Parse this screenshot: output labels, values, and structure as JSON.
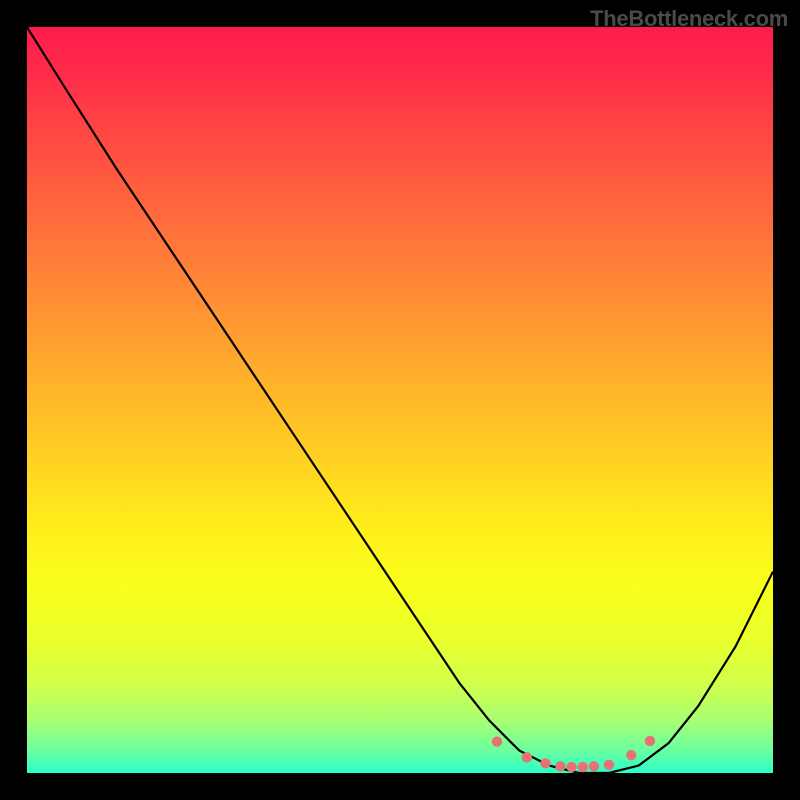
{
  "watermark": "TheBottleneck.com",
  "chart_data": {
    "type": "line",
    "title": "",
    "xlabel": "",
    "ylabel": "",
    "xlim": [
      0,
      100
    ],
    "ylim": [
      0,
      100
    ],
    "grid": false,
    "legend": false,
    "series": [
      {
        "name": "bottleneck-curve",
        "x": [
          0,
          5,
          12,
          20,
          28,
          36,
          44,
          52,
          58,
          62,
          66,
          70,
          74,
          78,
          82,
          86,
          90,
          95,
          100
        ],
        "y": [
          100,
          92,
          81,
          69,
          57,
          45,
          33,
          21,
          12,
          7,
          3,
          1,
          0,
          0,
          1,
          4,
          9,
          17,
          27
        ]
      }
    ],
    "scatter_points": {
      "name": "highlight-points",
      "x": [
        63,
        67,
        69.5,
        71.5,
        73,
        74.5,
        76,
        78,
        81,
        83.5
      ],
      "y": [
        4.2,
        2.1,
        1.3,
        0.9,
        0.8,
        0.8,
        0.9,
        1.1,
        2.4,
        4.3
      ]
    },
    "background_gradient": {
      "top": "#ff1a4d",
      "middle": "#ffd820",
      "bottom": "#2affc9"
    },
    "colors": {
      "curve": "#000000",
      "scatter": "#e57373",
      "frame": "#000000"
    }
  }
}
